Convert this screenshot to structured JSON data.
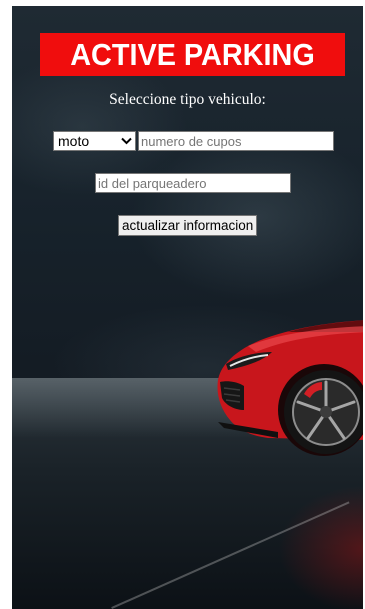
{
  "banner": {
    "title": "ACTIVE PARKING"
  },
  "form": {
    "subtitle": "Seleccione tipo vehiculo:",
    "vehicle_select": {
      "selected": "moto",
      "icon": "chevron-down-icon"
    },
    "capacity_input": {
      "value": "",
      "placeholder": "numero de cupos"
    },
    "lot_id_input": {
      "value": "",
      "placeholder": "id del parqueadero"
    },
    "update_button": {
      "label": "actualizar informacion"
    }
  },
  "colors": {
    "banner_bg": "#f00d0d",
    "banner_text": "#ffffff",
    "car_red": "#c8161c"
  }
}
